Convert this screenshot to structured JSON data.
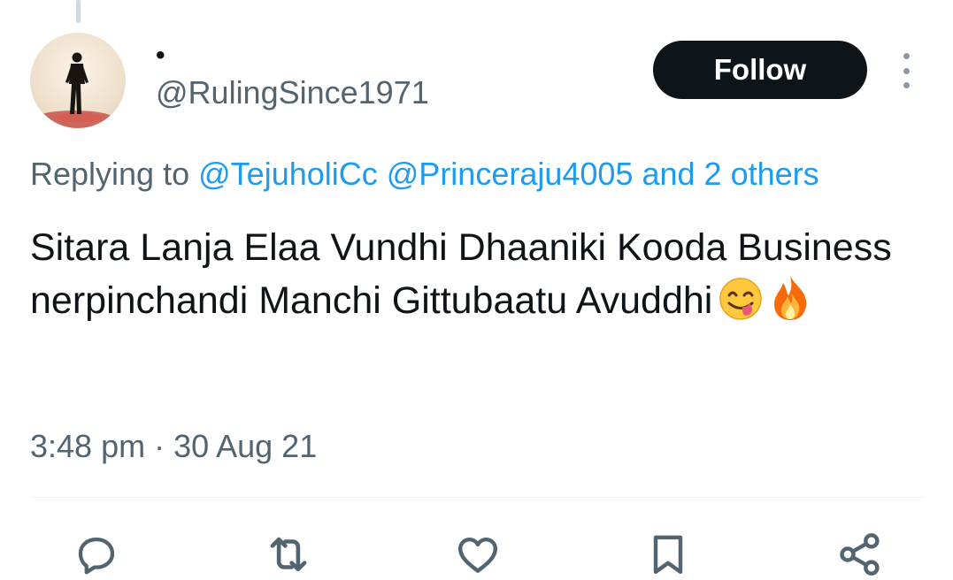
{
  "tweet": {
    "author": {
      "display_name": "•",
      "handle": "@RulingSince1971"
    },
    "follow_label": "Follow",
    "reply": {
      "prefix": "Replying to",
      "mention_1": "@TejuholiCc",
      "mention_2": "@Princeraju4005",
      "others": "and 2 others"
    },
    "text": "Sitara Lanja Elaa Vundhi Dhaaniki Kooda Business nerpinchandi Manchi Gittubaatu Avuddhi",
    "emojis": [
      "face-savoring-food",
      "fire"
    ],
    "timestamp": "3:48 pm · 30 Aug 21"
  },
  "actions": [
    "reply",
    "retweet",
    "like",
    "bookmark",
    "share"
  ],
  "colors": {
    "text": "#0f1419",
    "secondary": "#536471",
    "link": "#1d9bf0",
    "follow_bg": "#0f1419",
    "divider": "#eff3f4"
  }
}
